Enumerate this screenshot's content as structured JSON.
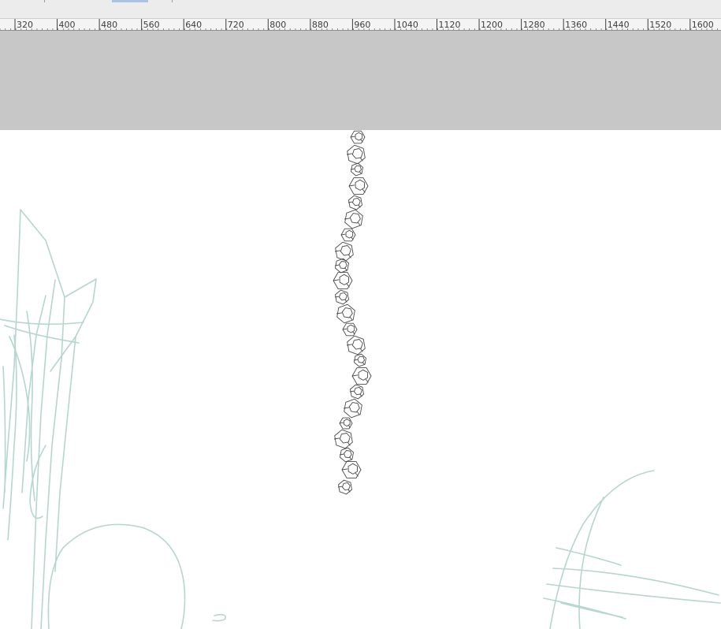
{
  "ruler": {
    "labels": [
      "320",
      "400",
      "480",
      "560",
      "640",
      "720",
      "800",
      "880",
      "960",
      "1040",
      "1120",
      "1200",
      "1280",
      "1360",
      "1440",
      "1520",
      "1600"
    ]
  },
  "colors": {
    "pasteboard": "#c7c7c7",
    "canvas": "#ffffff",
    "sketch_stroke": "#b4d6cf",
    "chain_stroke": "#4a4a4a"
  }
}
